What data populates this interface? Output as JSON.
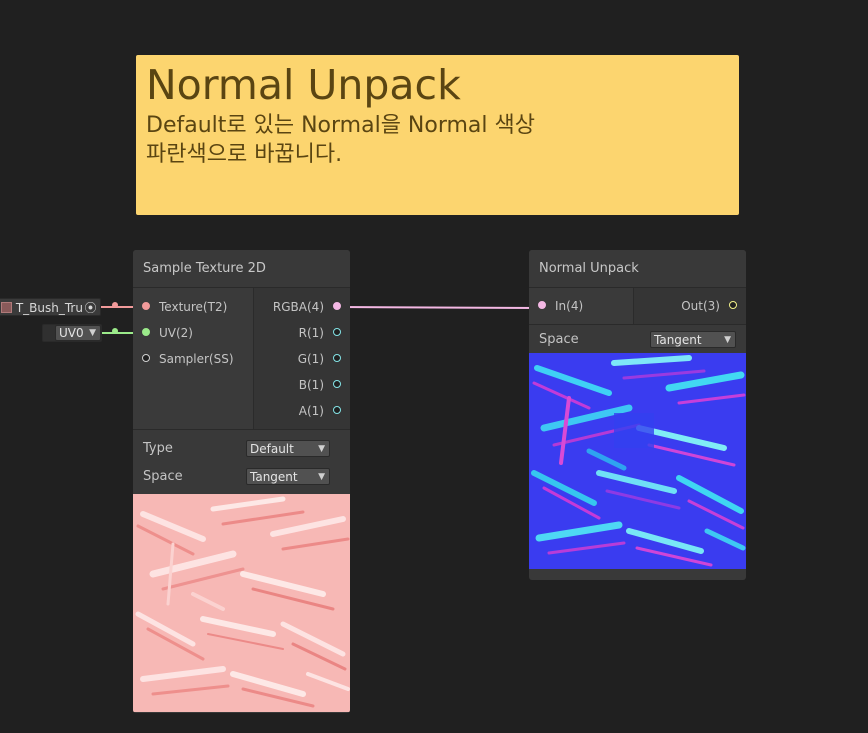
{
  "sticky_note": {
    "title": "Normal Unpack",
    "body": "Default로 있는 Normal을 Normal 색상\n파란색으로 바꿉니다."
  },
  "sample_texture_node": {
    "title": "Sample Texture 2D",
    "inputs": [
      {
        "label": "Texture(T2)",
        "color": "#f19a9a"
      },
      {
        "label": "UV(2)",
        "color": "#9bea8a"
      },
      {
        "label": "Sampler(SS)",
        "color": "#d0d0d0"
      }
    ],
    "outputs": [
      {
        "label": "RGBA(4)",
        "color": "#f4b8e4"
      },
      {
        "label": "R(1)",
        "color": "#84e4e7"
      },
      {
        "label": "G(1)",
        "color": "#84e4e7"
      },
      {
        "label": "B(1)",
        "color": "#84e4e7"
      },
      {
        "label": "A(1)",
        "color": "#84e4e7"
      }
    ],
    "settings": [
      {
        "label": "Type",
        "value": "Default"
      },
      {
        "label": "Space",
        "value": "Tangent"
      }
    ]
  },
  "normal_unpack_node": {
    "title": "Normal Unpack",
    "input": {
      "label": "In(4)",
      "color": "#f4b8e4"
    },
    "output": {
      "label": "Out(3)",
      "color": "#f4f28a"
    },
    "settings": [
      {
        "label": "Space",
        "value": "Tangent"
      }
    ]
  },
  "external_inputs": {
    "texture_field": "T_Bush_Trun",
    "uv_field": "UV0"
  },
  "colors": {
    "background": "#202020",
    "note": "#fcd56f",
    "node": "#393939",
    "wire_texture": "#f19a9a",
    "wire_uv": "#9bea8a",
    "wire_rgba": "#f4b8e4"
  },
  "icons": {
    "dropdown": "▼",
    "object_picker": "target-icon"
  }
}
